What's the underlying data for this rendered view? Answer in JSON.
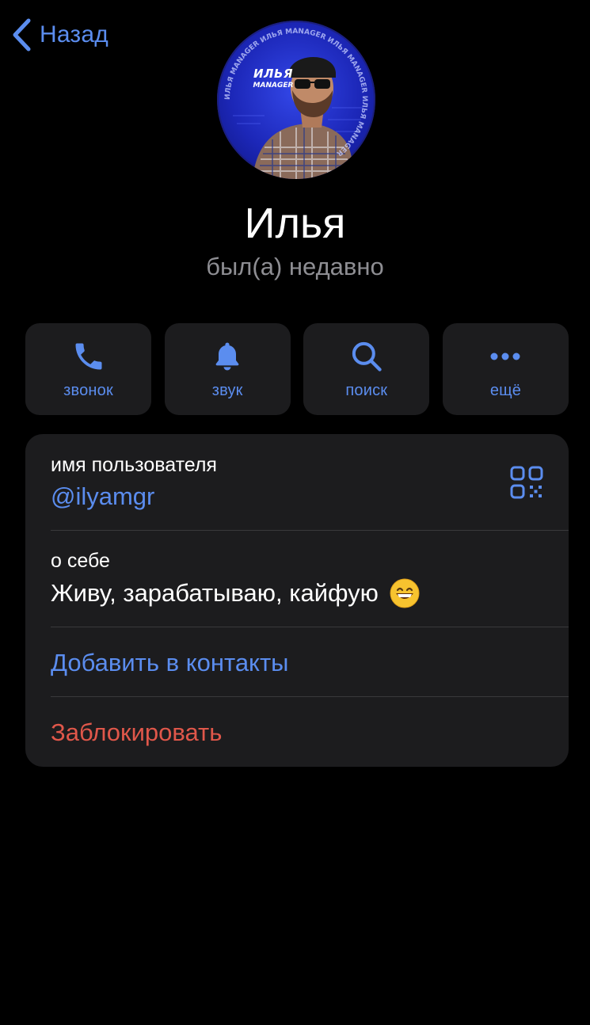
{
  "nav": {
    "back_label": "Назад"
  },
  "avatar": {
    "name_text": "ИЛЬЯ",
    "sub_text": "MANAGER",
    "ring_text": "ИЛЬЯ MANAGER ИЛЬЯ MANAGER ИЛЬЯ MANAGER ИЛЬЯ MANAGER"
  },
  "profile": {
    "name": "Илья",
    "status": "был(а) недавно"
  },
  "actions": [
    {
      "label": "звонок",
      "icon": "phone-icon"
    },
    {
      "label": "звук",
      "icon": "bell-icon"
    },
    {
      "label": "поиск",
      "icon": "search-icon"
    },
    {
      "label": "ещё",
      "icon": "more-icon"
    }
  ],
  "info": {
    "username_label": "имя пользователя",
    "username_value": "@ilyamgr",
    "bio_label": "о себе",
    "bio_value": "Живу, зарабатываю, кайфую",
    "bio_emoji": "grinning-face-emoji",
    "add_contact": "Добавить в контакты",
    "block": "Заблокировать"
  },
  "colors": {
    "background": "#000000",
    "accent": "#5b8def",
    "card": "#1c1c1e",
    "destructive": "#e0574a",
    "secondary_text": "#8e8e93"
  }
}
